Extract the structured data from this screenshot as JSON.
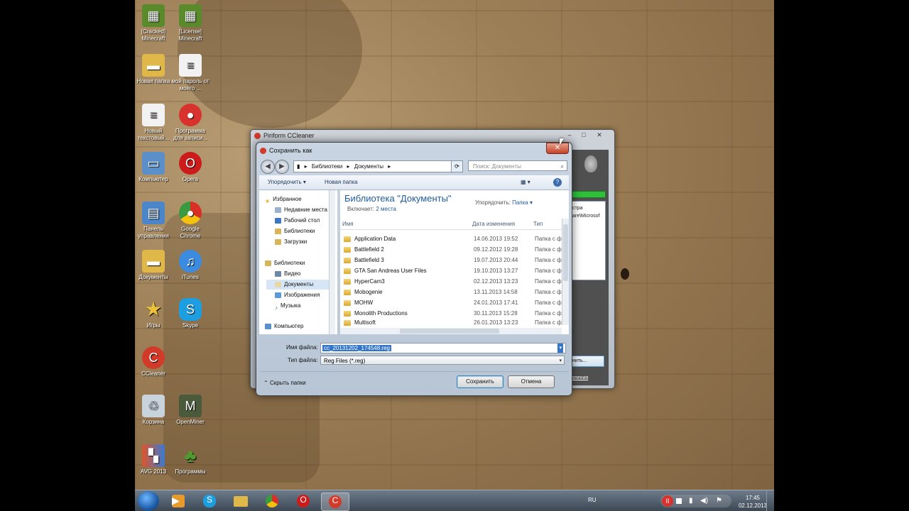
{
  "desktop": {
    "icons": [
      {
        "label": "[Cracked] Minecraft",
        "icon": "minecraft-grass-icon",
        "color": "#5a8a2c"
      },
      {
        "label": "[License] Minecraft",
        "icon": "minecraft-grass-icon",
        "color": "#5a8a2c"
      },
      {
        "label": "Новая папка",
        "icon": "folder-icon",
        "color": "#e0b84a"
      },
      {
        "label": "мой пароль от моего ...",
        "icon": "text-file-icon",
        "color": "#f2f2f2"
      },
      {
        "label": "Новый текстовый...",
        "icon": "text-file-icon",
        "color": "#f2f2f2"
      },
      {
        "label": "Программа для записи...",
        "icon": "record-icon",
        "color": "#d8322f"
      },
      {
        "label": "Компьютер",
        "icon": "computer-icon",
        "color": "#5b8fc9"
      },
      {
        "label": "Opera",
        "icon": "opera-icon",
        "color": "#cc1b1b"
      },
      {
        "label": "Панель управления",
        "icon": "control-panel-icon",
        "color": "#4a86c9"
      },
      {
        "label": "Google Chrome",
        "icon": "chrome-icon",
        "color": "#3a9a42"
      },
      {
        "label": "Документы",
        "icon": "documents-folder-icon",
        "color": "#e0b84a"
      },
      {
        "label": "iTunes",
        "icon": "itunes-icon",
        "color": "#3b8be0"
      },
      {
        "label": "Игры",
        "icon": "games-star-icon",
        "color": "#e9c23a"
      },
      {
        "label": "Skype",
        "icon": "skype-icon",
        "color": "#1c9ee0"
      },
      {
        "label": "CCleaner",
        "icon": "ccleaner-icon",
        "color": "#d23a2a"
      },
      {
        "label": "Корзина",
        "icon": "recycle-bin-icon",
        "color": "#c9d3dc"
      },
      {
        "label": "OpenMiner",
        "icon": "openminer-icon",
        "color": "#4a5a3a"
      },
      {
        "label": "AVG 2013",
        "icon": "avg-icon",
        "color": "#e0542a"
      },
      {
        "label": "Программы",
        "icon": "tree-icon",
        "color": "#4e9a2e"
      }
    ]
  },
  "ccleaner": {
    "title": "Piriform CCleaner",
    "partial_texts": [
      "стра",
      "are\\Microsof",
      "нить...",
      "еления"
    ]
  },
  "dialog": {
    "title": "Сохранить как",
    "address": {
      "path": [
        "Библиотеки",
        "Документы"
      ]
    },
    "search_placeholder": "Поиск: Документы",
    "toolbar": {
      "organize": "Упорядочить ▾",
      "new_folder": "Новая папка"
    },
    "nav": {
      "favorites": "Избранное",
      "favorites_items": [
        "Недавние места",
        "Рабочий стол",
        "Библиотеки",
        "Загрузки"
      ],
      "libraries": "Библиотеки",
      "libraries_items": [
        "Видео",
        "Документы",
        "Изображения",
        "Музыка"
      ],
      "computer": "Компьютер"
    },
    "library": {
      "title": "Библиотека \"Документы\"",
      "includes_label": "Включает:",
      "includes_link": "2 места",
      "arrange_label": "Упорядочить:",
      "arrange_value": "Папка ▾"
    },
    "columns": {
      "name": "Имя",
      "date": "Дата изменения",
      "type": "Тип"
    },
    "rows": [
      {
        "name": "Application Data",
        "date": "14.06.2013 19:52",
        "type": "Папка с ф"
      },
      {
        "name": "Battlefield 2",
        "date": "09.12.2012 19:28",
        "type": "Папка с ф"
      },
      {
        "name": "Battlefield 3",
        "date": "19.07.2013 20:44",
        "type": "Папка с ф"
      },
      {
        "name": "GTA San Andreas User Files",
        "date": "19.10.2013 13:27",
        "type": "Папка с ф"
      },
      {
        "name": "HyperCam3",
        "date": "02.12.2013 13:23",
        "type": "Папка с ф"
      },
      {
        "name": "Mobogenie",
        "date": "13.11.2013 14:58",
        "type": "Папка с ф"
      },
      {
        "name": "MOHW",
        "date": "24.01.2013 17:41",
        "type": "Папка с ф"
      },
      {
        "name": "Monolith Productions",
        "date": "30.11.2013 15:28",
        "type": "Папка с ф"
      },
      {
        "name": "Multisoft",
        "date": "26.01.2013 13:23",
        "type": "Папка с ф"
      }
    ],
    "file_name_label": "Имя файла:",
    "file_name_value": "cc_20131202_174548.reg",
    "file_type_label": "Тип файла:",
    "file_type_value": "Reg Files (*.reg)",
    "hide_folders": "Скрыть папки",
    "save": "Сохранить",
    "cancel": "Отмена"
  },
  "taskbar": {
    "language": "RU",
    "time": "17:45",
    "date": "02.12.2013",
    "apps": [
      "media-player-icon",
      "skype-icon",
      "explorer-folder-icon",
      "chrome-icon",
      "opera-icon",
      "ccleaner-icon"
    ]
  }
}
